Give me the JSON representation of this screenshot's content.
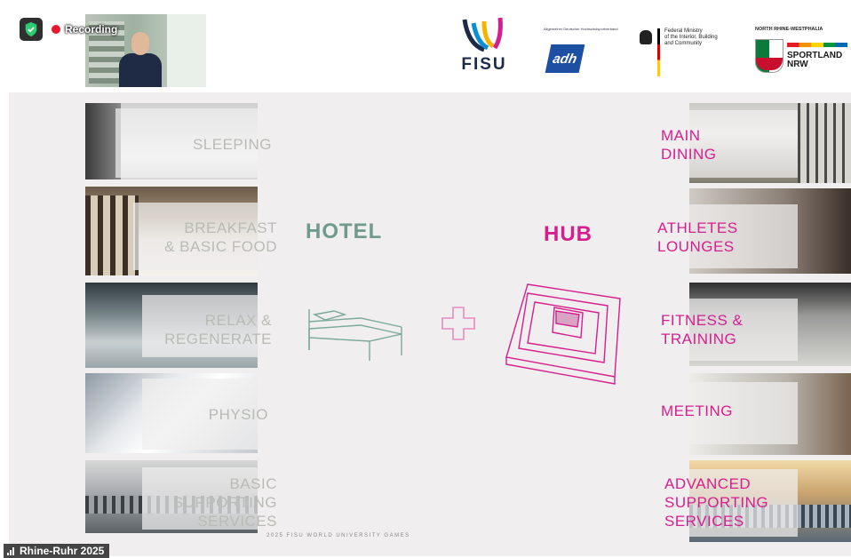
{
  "meeting": {
    "recording_label": "Recording",
    "participant_name": "Rhine-Ruhr 2025"
  },
  "logos": {
    "fisu": "FISU",
    "adh_caption": "Allgemeiner Deutscher Hochschulsportverband",
    "adh": "adh",
    "ministry": [
      "Federal Ministry",
      "of the Interior, Building",
      "and Community"
    ],
    "nrw_top": "NORTH RHINE-WESTPHALIA",
    "nrw_sport": [
      "SPORTLAND",
      "NRW"
    ]
  },
  "slide": {
    "hotel_title": "HOTEL",
    "hub_title": "HUB",
    "footer": "2025 FISU WORLD UNIVERSITY GAMES",
    "left_items": [
      {
        "lines": [
          "SLEEPING"
        ]
      },
      {
        "lines": [
          "BREAKFAST",
          "& BASIC FOOD"
        ]
      },
      {
        "lines": [
          "RELAX &",
          "REGENERATE"
        ]
      },
      {
        "lines": [
          "PHYSIO"
        ]
      },
      {
        "lines": [
          "BASIC",
          "SUPPORTING",
          "SERVICES"
        ]
      }
    ],
    "right_items": [
      {
        "lines": [
          "MAIN",
          "DINING"
        ]
      },
      {
        "lines": [
          "ATHLETES",
          "LOUNGES"
        ]
      },
      {
        "lines": [
          "FITNESS &",
          "TRAINING"
        ]
      },
      {
        "lines": [
          "MEETING"
        ]
      },
      {
        "lines": [
          "ADVANCED",
          "SUPPORTING",
          "SERVICES"
        ]
      }
    ]
  },
  "colors": {
    "hotel_green": "#6f9a8d",
    "hub_magenta": "#d61f8e",
    "slide_bg": "#f0eeee"
  }
}
